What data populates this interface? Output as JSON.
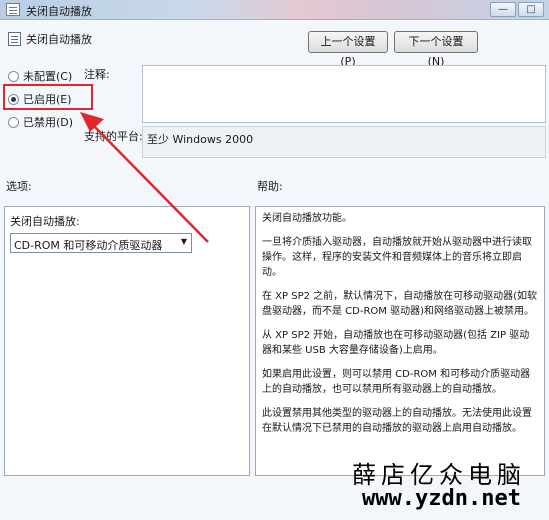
{
  "window": {
    "title": "关闭自动播放",
    "minimize_glyph": "—",
    "maximize_glyph": "□"
  },
  "header": {
    "policy_title": "关闭自动播放",
    "prev_button": "上一个设置(P)",
    "next_button": "下一个设置(N)"
  },
  "state": {
    "options": [
      {
        "label": "未配置(C)",
        "selected": false
      },
      {
        "label": "已启用(E)",
        "selected": true
      },
      {
        "label": "已禁用(D)",
        "selected": false
      }
    ],
    "highlight_color": "#e2262b"
  },
  "comment": {
    "label": "注释:",
    "value": ""
  },
  "platform": {
    "label": "支持的平台:",
    "value": "至少 Windows 2000"
  },
  "options_section": {
    "heading": "选项:",
    "field_label": "关闭自动播放:",
    "select_value": "CD-ROM 和可移动介质驱动器"
  },
  "help_section": {
    "heading": "帮助:",
    "paragraphs": [
      "关闭自动播放功能。",
      "一旦将介质插入驱动器，自动播放就开始从驱动器中进行读取操作。这样，程序的安装文件和音频媒体上的音乐将立即启动。",
      "在 XP SP2 之前，默认情况下，自动播放在可移动驱动器(如软盘驱动器，而不是 CD-ROM 驱动器)和网络驱动器上被禁用。",
      "从 XP SP2 开始，自动播放也在可移动驱动器(包括 ZIP 驱动器和某些 USB 大容量存储设备)上启用。",
      "如果启用此设置，则可以禁用 CD-ROM 和可移动介质驱动器上的自动播放，也可以禁用所有驱动器上的自动播放。",
      "此设置禁用其他类型的驱动器上的自动播放。无法使用此设置在默认情况下已禁用的自动播放的驱动器上启用自动播放。"
    ]
  },
  "watermark": {
    "text": "薛店亿众电脑",
    "url": "www.yzdn.net"
  },
  "annotation": {
    "arrow_color": "#e2262b"
  }
}
